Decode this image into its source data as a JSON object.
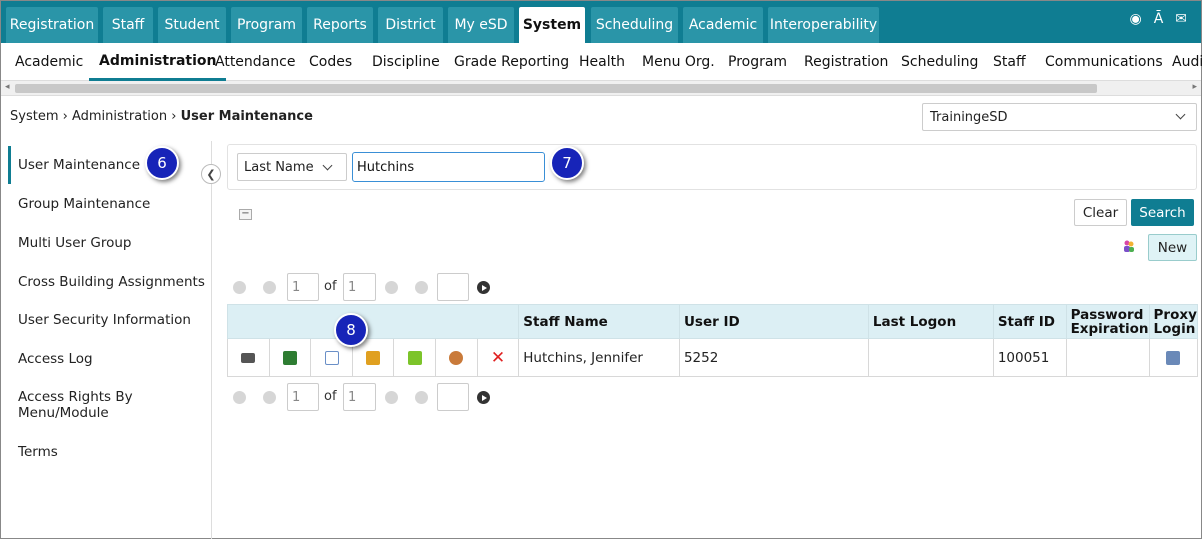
{
  "topnav": {
    "tabs": [
      {
        "label": "Registration",
        "active": false
      },
      {
        "label": "Staff",
        "active": false
      },
      {
        "label": "Student",
        "active": false
      },
      {
        "label": "Program",
        "active": false
      },
      {
        "label": "Reports",
        "active": false
      },
      {
        "label": "District",
        "active": false
      },
      {
        "label": "My eSD",
        "active": false
      },
      {
        "label": "System",
        "active": true
      },
      {
        "label": "Scheduling",
        "active": false
      },
      {
        "label": "Academic",
        "active": false
      },
      {
        "label": "Interoperability",
        "active": false
      }
    ],
    "icons": [
      "dashboard-icon",
      "font-size-icon",
      "mail-icon"
    ]
  },
  "subnav": {
    "items": [
      {
        "label": "Academic",
        "active": false
      },
      {
        "label": "Administration",
        "active": true
      },
      {
        "label": "Attendance",
        "active": false
      },
      {
        "label": "Codes",
        "active": false
      },
      {
        "label": "Discipline",
        "active": false
      },
      {
        "label": "Grade Reporting",
        "active": false
      },
      {
        "label": "Health",
        "active": false
      },
      {
        "label": "Menu Org.",
        "active": false
      },
      {
        "label": "Program",
        "active": false
      },
      {
        "label": "Registration",
        "active": false
      },
      {
        "label": "Scheduling",
        "active": false
      },
      {
        "label": "Staff",
        "active": false
      },
      {
        "label": "Communications",
        "active": false
      },
      {
        "label": "Audi",
        "active": false
      }
    ]
  },
  "breadcrumb": {
    "part1": "System",
    "sep": "›",
    "part2": "Administration",
    "current": "User Maintenance"
  },
  "district_select": {
    "value": "TrainingeSD"
  },
  "sidebar": {
    "items": [
      {
        "label": "User Maintenance",
        "active": true
      },
      {
        "label": "Group Maintenance"
      },
      {
        "label": "Multi User Group"
      },
      {
        "label": "Cross Building Assignments"
      },
      {
        "label": "User Security Information"
      },
      {
        "label": "Access Log"
      },
      {
        "label": "Access Rights By Menu/Module"
      },
      {
        "label": "Terms"
      }
    ]
  },
  "badges": {
    "b6": "6",
    "b7": "7",
    "b8": "8"
  },
  "search": {
    "field": "Last Name",
    "value": "Hutchins"
  },
  "buttons": {
    "clear": "Clear",
    "search": "Search",
    "new": "New"
  },
  "pager_top": {
    "page": "1",
    "of_label": "of",
    "total": "1"
  },
  "pager_bottom": {
    "page": "1",
    "of_label": "of",
    "total": "1"
  },
  "table": {
    "headers": {
      "staff_name": "Staff Name",
      "user_id": "User ID",
      "last_logon": "Last Logon",
      "staff_id": "Staff ID",
      "password_expiration": "Password Expiration",
      "proxy_login": "Proxy Login"
    },
    "rows": [
      {
        "staff_name": "Hutchins, Jennifer",
        "user_id": "5252",
        "last_logon": "",
        "staff_id": "100051",
        "password_expiration": ""
      }
    ],
    "row_icons": [
      "print-icon",
      "excel-export-icon",
      "edit-icon",
      "security-icon",
      "copy-icon",
      "user-groups-icon",
      "delete-icon"
    ]
  },
  "colors": {
    "primary": "#0f7d92",
    "tab": "#2a95a8",
    "header_bg": "#dceff4",
    "badge": "#1724b8"
  }
}
